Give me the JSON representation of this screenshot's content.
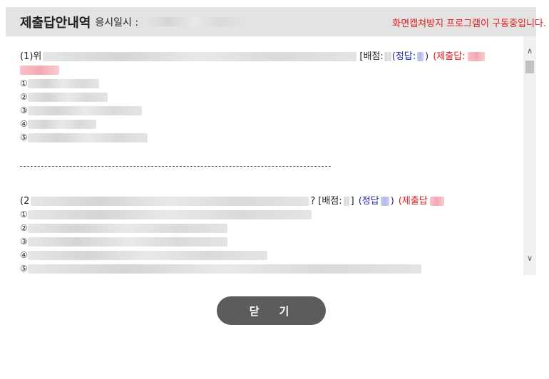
{
  "header": {
    "title": "제출답안내역",
    "exam_time_label": "응시일시 :",
    "capture_warning": "화면캡쳐방지 프로그램이 구동중입니다."
  },
  "questions": [
    {
      "number_prefix": "(1)위",
      "score_label": "[배점:",
      "answer_label": "(정답:",
      "answer_close": ")",
      "submitted_label": "(제출답:",
      "options": [
        "①",
        "②",
        "③",
        "④",
        "⑤"
      ]
    },
    {
      "number_prefix": "(2",
      "question_end": "?",
      "score_label": "[배점:",
      "score_close": "]",
      "answer_label": "(정답",
      "answer_close": ")",
      "submitted_label": "(제출답",
      "options": [
        "①",
        "②",
        "③",
        "④",
        "⑤"
      ]
    }
  ],
  "close_button": {
    "label": "닫기"
  },
  "colors": {
    "header_bg": "#e3e3e3",
    "warning": "#e0191e",
    "answer": "#1f1fb0",
    "button_bg": "#5c5c5c"
  }
}
